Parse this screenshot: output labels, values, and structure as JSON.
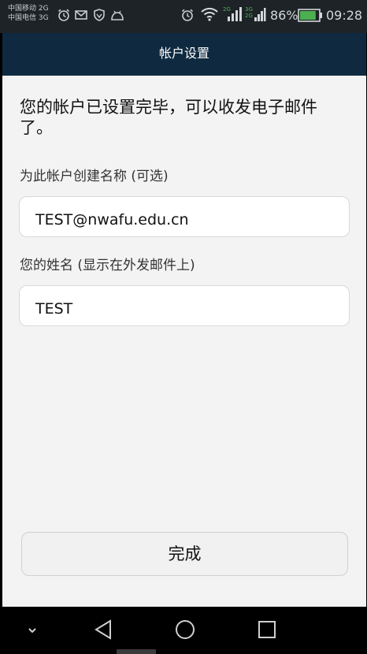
{
  "status_bar": {
    "carrier_1": "中国移动 2G",
    "carrier_2": "中国电信 3G",
    "battery_percent": "86%",
    "time": "09:28",
    "icons_left": [
      "alarm-icon",
      "mail-icon",
      "shield-icon",
      "android-icon"
    ],
    "icons_right": [
      "alarm-icon",
      "wifi-icon",
      "signal-icon",
      "signal-icon",
      "battery-icon"
    ],
    "battery_level": 0.86
  },
  "action_bar": {
    "title": "帐户设置"
  },
  "main": {
    "headline": "您的帐户已设置完毕，可以收发电子邮件了。",
    "account_name_label": "为此帐户创建名称 (可选)",
    "account_name_value": "TEST@nwafu.edu.cn",
    "your_name_label": "您的姓名 (显示在外发邮件上)",
    "your_name_value": "TEST",
    "done_label": "完成"
  },
  "nav_bar": {
    "items": [
      "hide-keyboard-icon",
      "back-icon",
      "home-icon",
      "recents-icon"
    ]
  },
  "colors": {
    "status_bar_bg": "#1e2327",
    "action_bar_bg": "#0f2a40",
    "content_bg": "#f3f3f3",
    "nav_bar_bg": "#000000"
  }
}
